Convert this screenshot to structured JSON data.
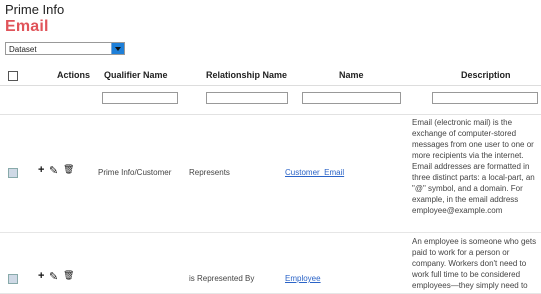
{
  "breadcrumb": "Prime Info",
  "title": "Email",
  "dataset": {
    "selected": "Dataset"
  },
  "table": {
    "headers": {
      "actions": "Actions",
      "qualifier": "Qualifier Name",
      "relationship": "Relationship Name",
      "name": "Name",
      "description": "Description"
    },
    "rows": [
      {
        "qualifier": "Prime Info/Customer",
        "relationship": "Represents",
        "name": "Customer_Email",
        "description": "Email (electronic mail) is the exchange of computer-stored messages from one user to one or more recipients via the internet. Email addresses are formatted in three distinct parts: a local-part, an \"@\" symbol, and a domain. For example, in the email address employee@example.com"
      },
      {
        "qualifier": "",
        "relationship": "is Represented By",
        "name": "Employee",
        "description": "An employee is someone who gets paid to work for a person or company. Workers don't need to work full time to be considered employees—they simply need to"
      }
    ]
  },
  "icons": {
    "add": "+",
    "edit": "✎",
    "delete": "🗑"
  }
}
